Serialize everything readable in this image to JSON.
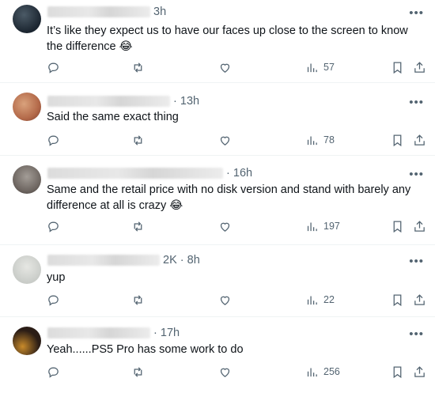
{
  "replies": [
    {
      "time": "3h",
      "text": "It’s like they expect us to have our faces up close to the screen to know the difference 😂",
      "views": "57",
      "avatar_colors": [
        "#1b2530",
        "#4b5a66"
      ]
    },
    {
      "time": "· 13h",
      "text": "Said the same exact thing",
      "views": "78",
      "avatar_colors": [
        "#b46a4a",
        "#d9a27c"
      ]
    },
    {
      "time": "· 16h",
      "text": "Same and the retail price with no disk version and stand with barely any difference at all is crazy 😂",
      "views": "197",
      "avatar_colors": [
        "#6d6560",
        "#a39d97"
      ]
    },
    {
      "time": "2K · 8h",
      "text": "yup",
      "views": "22",
      "avatar_colors": [
        "#c9ccc8",
        "#e6e7e3"
      ]
    },
    {
      "time": "· 17h",
      "text": "Yeah......PS5 Pro has some work to do",
      "views": "256",
      "avatar_colors": [
        "#2b1d16",
        "#c88a2a"
      ]
    }
  ],
  "icons": {
    "more": "more-dots-icon",
    "reply": "reply-icon",
    "repost": "repost-icon",
    "like": "like-icon",
    "views": "views-icon",
    "bookmark": "bookmark-icon",
    "share": "share-icon"
  }
}
